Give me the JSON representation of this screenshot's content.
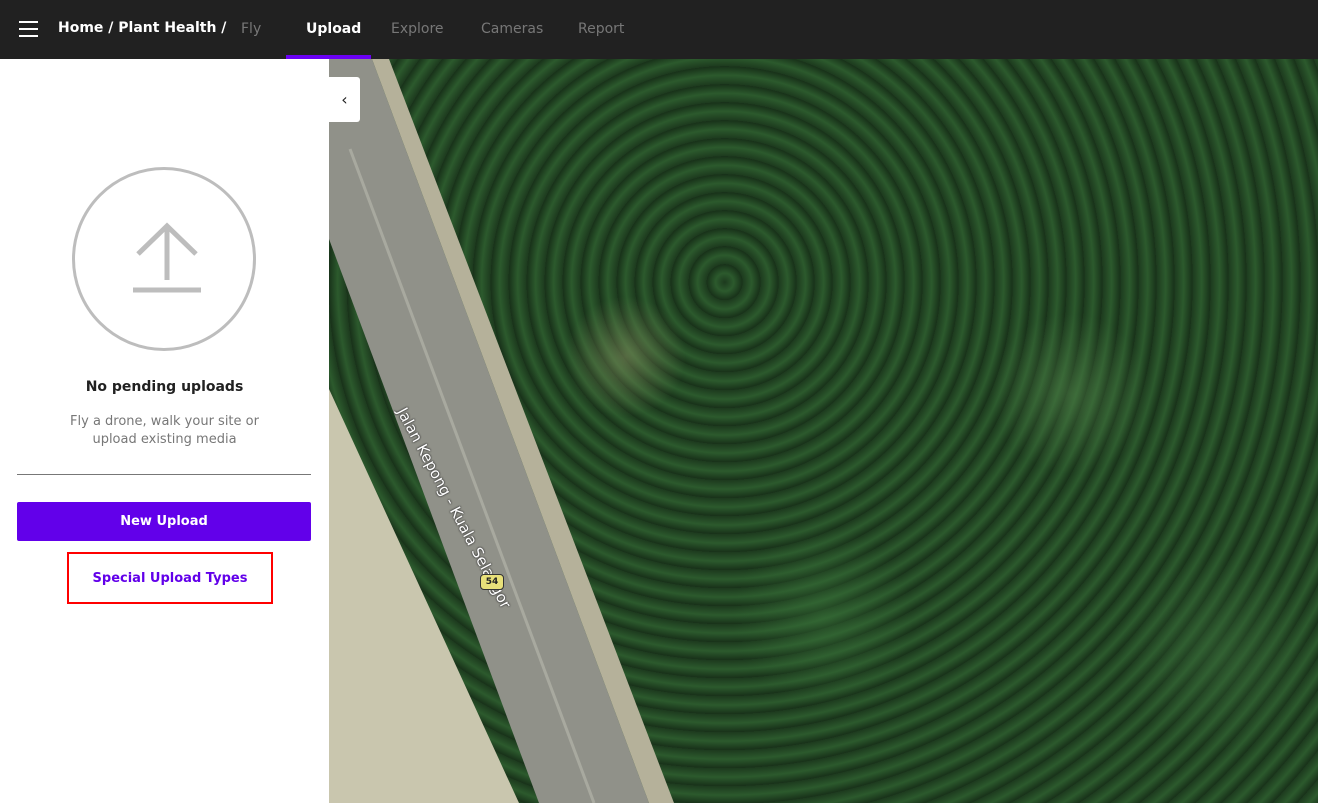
{
  "header": {
    "breadcrumb": "Home / Plant Health /",
    "tabs": [
      {
        "label": "Fly"
      },
      {
        "label": "Upload",
        "active": true
      },
      {
        "label": "Explore"
      },
      {
        "label": "Cameras"
      },
      {
        "label": "Report"
      }
    ],
    "accent": "#6200ea"
  },
  "panel": {
    "title": "No pending uploads",
    "subtitle_line1": "Fly a drone, walk your site or",
    "subtitle_line2": "upload existing media",
    "new_upload_label": "New Upload",
    "special_label": "Special Upload Types"
  },
  "map": {
    "road_label": "Jalan Kepong - Kuala Selangor",
    "route_sign": "54"
  }
}
